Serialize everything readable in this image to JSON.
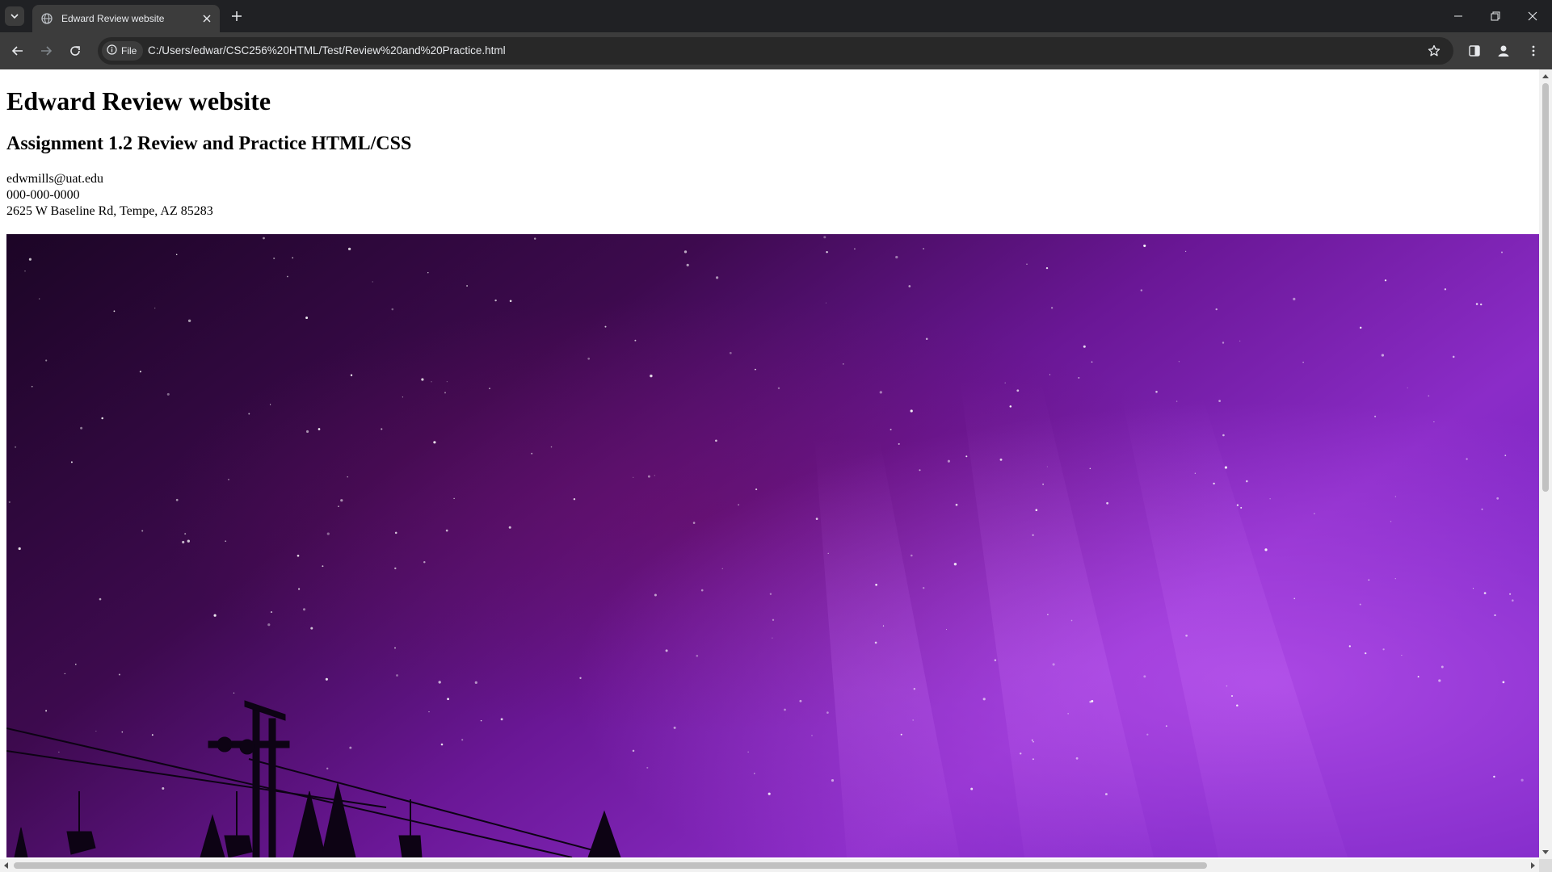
{
  "browser": {
    "tab_title": "Edward Review website",
    "site_chip_label": "File",
    "url": "C:/Users/edwar/CSC256%20HTML/Test/Review%20and%20Practice.html",
    "icons": [
      "tab-search-icon",
      "globe-icon",
      "close-icon",
      "new-tab-icon",
      "minimize-icon",
      "restore-icon",
      "window-close-icon",
      "back-icon",
      "forward-icon",
      "reload-icon",
      "info-icon",
      "bookmark-star-icon",
      "side-panel-icon",
      "profile-icon",
      "menu-icon"
    ]
  },
  "page": {
    "heading": "Edward Review website",
    "subheading": "Assignment 1.2 Review and Practice HTML/CSS",
    "email": "edwmills@uat.edu",
    "phone": "000-000-0000",
    "address": "2625 W Baseline Rd, Tempe, AZ 85283"
  },
  "colors": {
    "chrome_dark": "#202124",
    "toolbar": "#3c3c3c",
    "sky_dark": "#1a0528",
    "sky_purple": "#7a1fb0",
    "sky_bright": "#b04ae8"
  }
}
